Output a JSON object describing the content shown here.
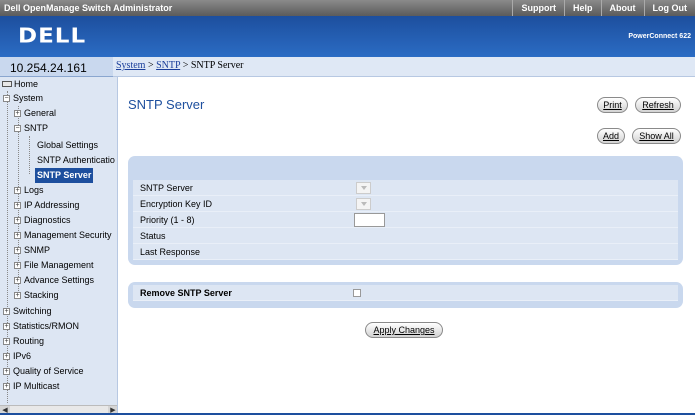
{
  "topbar": {
    "title": "Dell OpenManage Switch Administrator",
    "links": [
      "Support",
      "Help",
      "About",
      "Log Out"
    ]
  },
  "brand": {
    "logo": "DELL",
    "product": "PowerConnect 622"
  },
  "ip_address": "10.254.24.161",
  "breadcrumb": {
    "system": "System",
    "sep1": " > ",
    "sntp": "SNTP",
    "sep2": " > ",
    "current": "SNTP Server"
  },
  "sidebar": {
    "items": [
      {
        "label": "Home"
      },
      {
        "label": "System"
      },
      {
        "label": "General"
      },
      {
        "label": "SNTP"
      },
      {
        "label": "Global Settings"
      },
      {
        "label": "SNTP Authenticatio"
      },
      {
        "label": "SNTP Server"
      },
      {
        "label": "Logs"
      },
      {
        "label": "IP Addressing"
      },
      {
        "label": "Diagnostics"
      },
      {
        "label": "Management Security"
      },
      {
        "label": "SNMP"
      },
      {
        "label": "File Management"
      },
      {
        "label": "Advance Settings"
      },
      {
        "label": "Stacking"
      },
      {
        "label": "Switching"
      },
      {
        "label": "Statistics/RMON"
      },
      {
        "label": "Routing"
      },
      {
        "label": "IPv6"
      },
      {
        "label": "Quality of Service"
      },
      {
        "label": "IP Multicast"
      }
    ]
  },
  "page": {
    "title": "SNTP Server",
    "buttons": {
      "print": "Print",
      "refresh": "Refresh",
      "add": "Add",
      "show_all": "Show All",
      "apply": "Apply Changes"
    }
  },
  "form": {
    "sntp_server": "SNTP Server",
    "encryption_key_id": "Encryption Key ID",
    "priority": "Priority (1 - 8)",
    "status": "Status",
    "last_response": "Last Response"
  },
  "remove": {
    "label": "Remove SNTP Server"
  },
  "colors": {
    "brand_blue": "#1d4f9e",
    "panel_bg": "#c9d8ee",
    "row_bg": "#dde6f3"
  }
}
